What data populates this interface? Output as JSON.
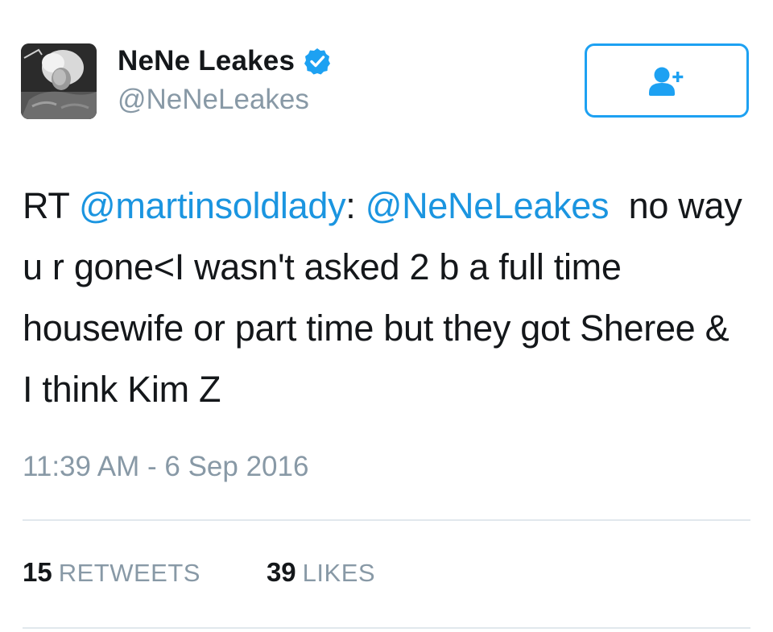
{
  "author": {
    "display_name": "NeNe Leakes",
    "handle": "@NeNeLeakes",
    "verified": true,
    "avatar_icon": "profile-photo"
  },
  "follow_button": {
    "icon": "add-user-icon"
  },
  "tweet": {
    "prefix": "RT ",
    "mention1": "@martinsoldlady",
    "sep": ": ",
    "mention2": "@NeNeLeakes",
    "body": "  no way u r gone<I wasn't asked 2 b a full time housewife or part time but they got Sheree & I think Kim Z"
  },
  "timestamp": "11:39 AM - 6 Sep 2016",
  "stats": {
    "retweets_count": "15",
    "retweets_label": "RETWEETS",
    "likes_count": "39",
    "likes_label": "LIKES"
  },
  "colors": {
    "accent": "#1da1f2",
    "mention": "#1b95e0",
    "muted": "#8899a6",
    "text": "#14171a",
    "divider": "#e1e8ed"
  }
}
